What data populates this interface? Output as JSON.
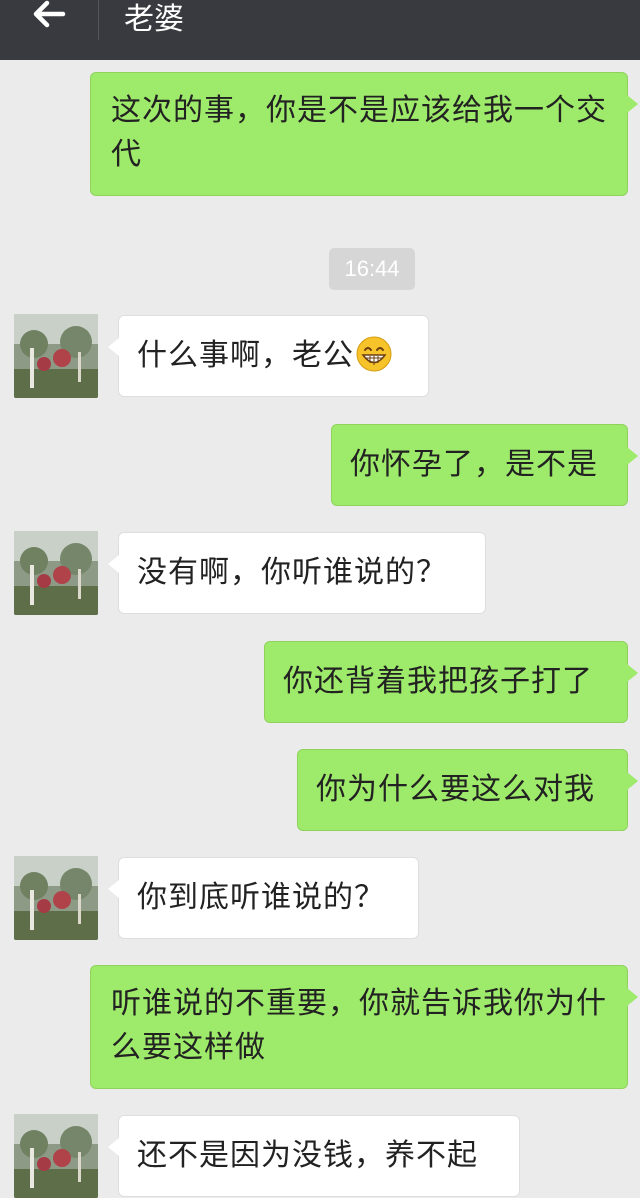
{
  "header": {
    "title": "老婆",
    "back_icon": "arrow-left-icon"
  },
  "timestamp": "16:44",
  "messages": [
    {
      "side": "out",
      "text": "这次的事，你是不是应该给我一个交代"
    },
    {
      "side": "in",
      "text": "什么事啊，老公",
      "emoji": "grinning-face-icon"
    },
    {
      "side": "out",
      "text": "你怀孕了，是不是"
    },
    {
      "side": "in",
      "text": "没有啊，你听谁说的？"
    },
    {
      "side": "out",
      "text": "你还背着我把孩子打了"
    },
    {
      "side": "out",
      "text": "你为什么要这么对我"
    },
    {
      "side": "in",
      "text": "你到底听谁说的？"
    },
    {
      "side": "out",
      "text": "听谁说的不重要，你就告诉我你为什么要这样做"
    },
    {
      "side": "in",
      "text": "还不是因为没钱，养不起"
    }
  ],
  "colors": {
    "topbar": "#393a3f",
    "background": "#ebebeb",
    "outgoing_bubble": "#9eea6a",
    "incoming_bubble": "#ffffff"
  }
}
